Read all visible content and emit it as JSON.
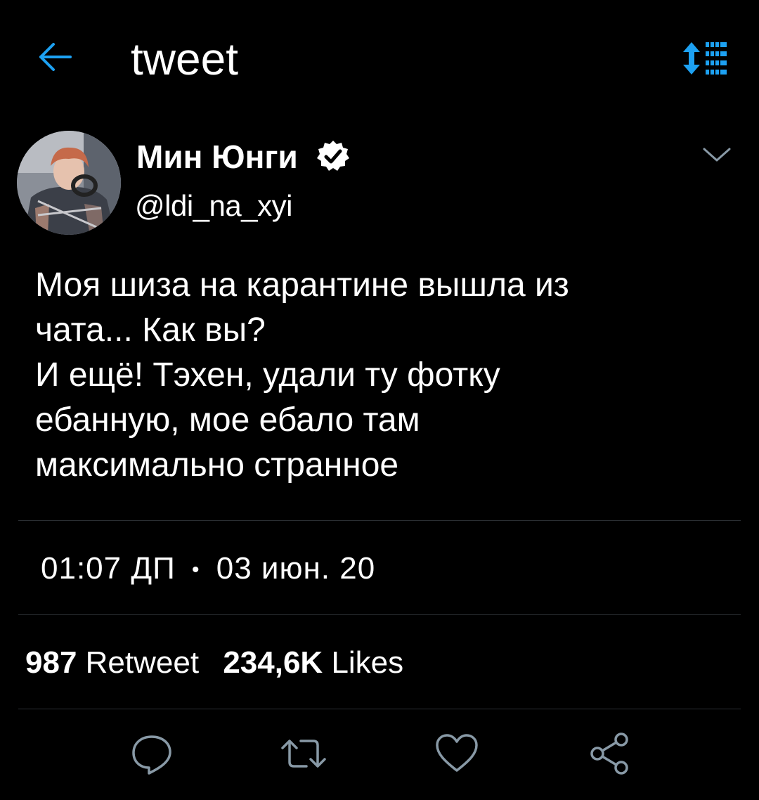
{
  "header": {
    "title": "tweet",
    "back_icon": "arrow-left-icon",
    "sort_icon": "sort-icon",
    "accent_color": "#1da1f2"
  },
  "author": {
    "name": "Мин Юнги",
    "handle": "@ldi_na_xyi",
    "verified": true
  },
  "tweet": {
    "text": "Моя шиза на карантине вышла из\nчата... Как вы?\nИ ещё! Тэхен, удали ту фотку\nебанную, мое ебало там\nмаксимально странное",
    "time": "01:07 ДП",
    "separator": "•",
    "date": "03 июн. 20"
  },
  "stats": {
    "retweets_count": "987",
    "retweets_label": "Retweet",
    "likes_count": "234,6K",
    "likes_label": "Likes"
  },
  "actions": [
    {
      "name": "reply",
      "icon": "comment-icon"
    },
    {
      "name": "retweet",
      "icon": "retweet-icon"
    },
    {
      "name": "like",
      "icon": "heart-icon"
    },
    {
      "name": "share",
      "icon": "share-icon"
    }
  ],
  "colors": {
    "background": "#000000",
    "text": "#ffffff",
    "icon_gray": "#8899a6",
    "divider": "#2b2f33"
  }
}
